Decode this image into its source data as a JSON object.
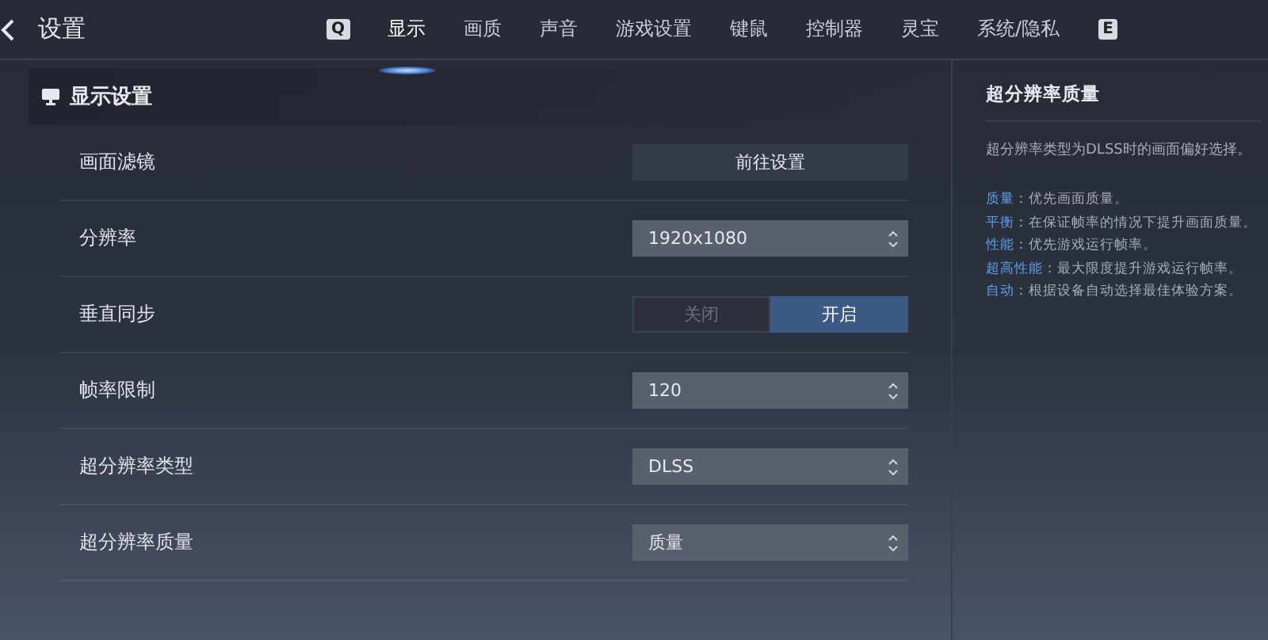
{
  "header": {
    "title": "设置",
    "key_left": "Q",
    "key_right": "E",
    "tabs": [
      {
        "label": "显示",
        "selected": true
      },
      {
        "label": "画质",
        "selected": false
      },
      {
        "label": "声音",
        "selected": false
      },
      {
        "label": "游戏设置",
        "selected": false
      },
      {
        "label": "键鼠",
        "selected": false
      },
      {
        "label": "控制器",
        "selected": false
      },
      {
        "label": "灵宝",
        "selected": false
      },
      {
        "label": "系统/隐私",
        "selected": false
      }
    ]
  },
  "section": {
    "title": "显示设置",
    "rows": [
      {
        "label": "画面滤镜",
        "kind": "button",
        "value": "前往设置"
      },
      {
        "label": "分辨率",
        "kind": "select",
        "value": "1920x1080"
      },
      {
        "label": "垂直同步",
        "kind": "toggle",
        "options": [
          {
            "label": "关闭",
            "selected": false
          },
          {
            "label": "开启",
            "selected": true
          }
        ]
      },
      {
        "label": "帧率限制",
        "kind": "select",
        "value": "120"
      },
      {
        "label": "超分辨率类型",
        "kind": "select",
        "value": "DLSS"
      },
      {
        "label": "超分辨率质量",
        "kind": "select",
        "value": "质量"
      }
    ]
  },
  "help": {
    "title": "超分辨率质量",
    "description": "超分辨率类型为DLSS时的画面偏好选择。",
    "items": [
      {
        "term": "质量",
        "text": "：优先画面质量。"
      },
      {
        "term": "平衡",
        "text": "：在保证帧率的情况下提升画面质量。"
      },
      {
        "term": "性能",
        "text": "：优先游戏运行帧率。"
      },
      {
        "term": "超高性能",
        "text": "：最大限度提升游戏运行帧率。"
      },
      {
        "term": "自动",
        "text": "：根据设备自动选择最佳体验方案。"
      }
    ]
  }
}
